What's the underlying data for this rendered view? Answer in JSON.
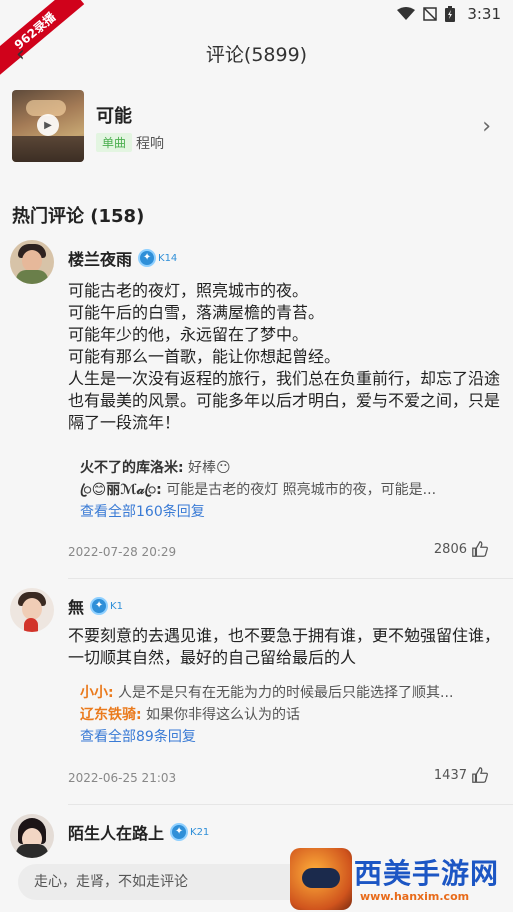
{
  "status": {
    "time": "3:31",
    "corner_badge": "962录播"
  },
  "header": {
    "title": "评论(5899)"
  },
  "song": {
    "title": "可能",
    "tag": "单曲",
    "artist": "程响"
  },
  "section": {
    "title": "热门评论 (158)"
  },
  "comments": [
    {
      "name": "楼兰夜雨",
      "level": "K14",
      "text": "可能古老的夜灯，照亮城市的夜。\n可能午后的白雪，落满屋檐的青苔。\n可能年少的他，永远留在了梦中。\n可能有那么一首歌，能让你想起曾经。\n人生是一次没有返程的旅行，我们总在负重前行，却忘了沿途也有最美的风景。可能多年以后才明白，爱与不爱之间，只是隔了一段流年！",
      "replies": [
        {
          "name": "火不了的库洛米:",
          "text": " 好棒😶"
        },
        {
          "name": "ꦿ😊丽ℳ𝒶ꦿ:",
          "text": " 可能是古老的夜灯 照亮城市的夜，可能是..."
        }
      ],
      "view_all": "查看全部160条回复",
      "date": "2022-07-28 20:29",
      "likes": "2806"
    },
    {
      "name": "無",
      "level": "K1",
      "text": "不要刻意的去遇见谁，也不要急于拥有谁，更不勉强留住谁，一切顺其自然，最好的自己留给最后的人",
      "replies": [
        {
          "name": "小小:",
          "text": " 人是不是只有在无能为力的时候最后只能选择了顺其..."
        },
        {
          "name": "辽东铁骑:",
          "text": " 如果你非得这么认为的话"
        }
      ],
      "view_all": "查看全部89条回复",
      "date": "2022-06-25 21:03",
      "likes": "1437"
    },
    {
      "name": "陌生人在路上",
      "level": "K21"
    }
  ],
  "input": {
    "placeholder": "走心，走肾，不如走评论"
  },
  "watermark": {
    "text": "西美手游网",
    "url": "www.hanxim.com"
  },
  "icons": {
    "back": "back-arrow-icon",
    "chevron": "chevron-right-icon",
    "thumb": "thumb-up-icon",
    "wifi": "wifi-icon",
    "signal": "no-signal-icon",
    "battery": "battery-icon"
  },
  "colors": {
    "link": "#3a7bd5",
    "tag_bg": "#e3f5e1",
    "tag_text": "#4caf50",
    "level": "#2f8fd8",
    "orange_name": "#ea7a1d"
  }
}
